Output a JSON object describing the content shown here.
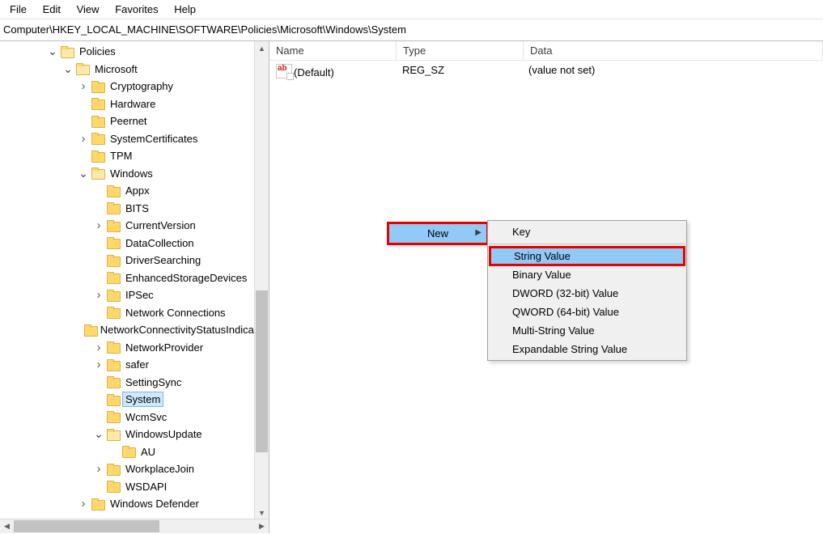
{
  "menu": {
    "file": "File",
    "edit": "Edit",
    "view": "View",
    "favorites": "Favorites",
    "help": "Help"
  },
  "address": "Computer\\HKEY_LOCAL_MACHINE\\SOFTWARE\\Policies\\Microsoft\\Windows\\System",
  "list": {
    "headers": {
      "name": "Name",
      "type": "Type",
      "data": "Data"
    },
    "rows": [
      {
        "name": "(Default)",
        "type": "REG_SZ",
        "data": "(value not set)"
      }
    ]
  },
  "tree": [
    {
      "indent": 3,
      "twisty": "open",
      "label": "Policies"
    },
    {
      "indent": 4,
      "twisty": "open",
      "label": "Microsoft"
    },
    {
      "indent": 5,
      "twisty": "closed",
      "label": "Cryptography"
    },
    {
      "indent": 5,
      "twisty": "none",
      "label": "Hardware"
    },
    {
      "indent": 5,
      "twisty": "none",
      "label": "Peernet"
    },
    {
      "indent": 5,
      "twisty": "closed",
      "label": "SystemCertificates"
    },
    {
      "indent": 5,
      "twisty": "none",
      "label": "TPM"
    },
    {
      "indent": 5,
      "twisty": "open",
      "label": "Windows"
    },
    {
      "indent": 6,
      "twisty": "none",
      "label": "Appx"
    },
    {
      "indent": 6,
      "twisty": "none",
      "label": "BITS"
    },
    {
      "indent": 6,
      "twisty": "closed",
      "label": "CurrentVersion"
    },
    {
      "indent": 6,
      "twisty": "none",
      "label": "DataCollection"
    },
    {
      "indent": 6,
      "twisty": "none",
      "label": "DriverSearching"
    },
    {
      "indent": 6,
      "twisty": "none",
      "label": "EnhancedStorageDevices"
    },
    {
      "indent": 6,
      "twisty": "closed",
      "label": "IPSec"
    },
    {
      "indent": 6,
      "twisty": "none",
      "label": "Network Connections"
    },
    {
      "indent": 6,
      "twisty": "none",
      "label": "NetworkConnectivityStatusIndicator"
    },
    {
      "indent": 6,
      "twisty": "closed",
      "label": "NetworkProvider"
    },
    {
      "indent": 6,
      "twisty": "closed",
      "label": "safer"
    },
    {
      "indent": 6,
      "twisty": "none",
      "label": "SettingSync"
    },
    {
      "indent": 6,
      "twisty": "none",
      "label": "System",
      "selected": true
    },
    {
      "indent": 6,
      "twisty": "none",
      "label": "WcmSvc"
    },
    {
      "indent": 6,
      "twisty": "open",
      "label": "WindowsUpdate"
    },
    {
      "indent": 7,
      "twisty": "none",
      "label": "AU"
    },
    {
      "indent": 6,
      "twisty": "closed",
      "label": "WorkplaceJoin"
    },
    {
      "indent": 6,
      "twisty": "none",
      "label": "WSDAPI"
    },
    {
      "indent": 5,
      "twisty": "closed",
      "label": "Windows Defender"
    }
  ],
  "ctx1": {
    "new": "New"
  },
  "ctx2": {
    "key": "Key",
    "string": "String Value",
    "binary": "Binary Value",
    "dword": "DWORD (32-bit) Value",
    "qword": "QWORD (64-bit) Value",
    "multi": "Multi-String Value",
    "expand": "Expandable String Value"
  }
}
